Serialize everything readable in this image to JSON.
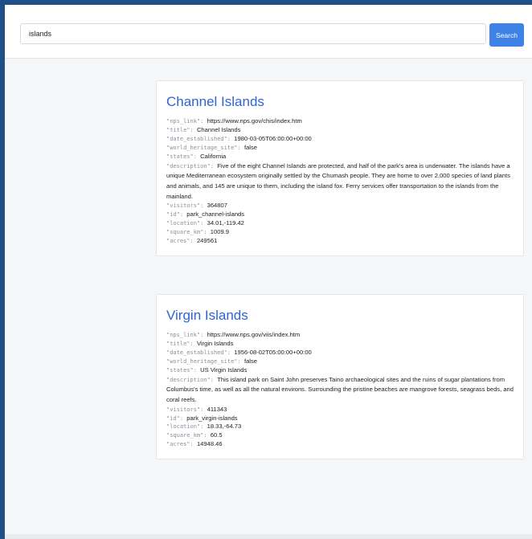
{
  "search": {
    "value": "islands",
    "button_label": "Search"
  },
  "results": [
    {
      "title": "Channel Islands",
      "fields": [
        {
          "key": "\"nps_link\"",
          "value": "https://www.nps.gov/chis/index.htm"
        },
        {
          "key": "\"title\"",
          "value": "Channel Islands"
        },
        {
          "key": "\"date_established\"",
          "value": "1980-03-05T06:00:00+00:00"
        },
        {
          "key": "\"world_heritage_site\"",
          "value": "false"
        },
        {
          "key": "\"states\"",
          "value": "California"
        },
        {
          "key": "\"description\"",
          "value": "Five of the eight Channel Islands are protected, and half of the park's area is underwater. The islands have a unique Mediterranean ecosystem originally settled by the Chumash people. They are home to over 2,000 species of land plants and animals, and 145 are unique to them, including the island fox. Ferry services offer transportation to the islands from the mainland."
        },
        {
          "key": "\"visitors\"",
          "value": "364807"
        },
        {
          "key": "\"id\"",
          "value": "park_channel-islands"
        },
        {
          "key": "\"location\"",
          "value": "34.01,-119.42"
        },
        {
          "key": "\"square_km\"",
          "value": "1009.9"
        },
        {
          "key": "\"acres\"",
          "value": "249561"
        }
      ]
    },
    {
      "title": "Virgin Islands",
      "fields": [
        {
          "key": "\"nps_link\"",
          "value": "https://www.nps.gov/viis/index.htm"
        },
        {
          "key": "\"title\"",
          "value": "Virgin Islands"
        },
        {
          "key": "\"date_established\"",
          "value": "1956-08-02T05:00:00+00:00"
        },
        {
          "key": "\"world_heritage_site\"",
          "value": "false"
        },
        {
          "key": "\"states\"",
          "value": "US Virgin Islands"
        },
        {
          "key": "\"description\"",
          "value": "This island park on Saint John preserves Taino archaeological sites and the ruins of sugar plantations from Columbus's time, as well as all the natural environs. Surrounding the pristine beaches are mangrove forests, seagrass beds, and coral reefs."
        },
        {
          "key": "\"visitors\"",
          "value": "411343"
        },
        {
          "key": "\"id\"",
          "value": "park_virgin-islands"
        },
        {
          "key": "\"location\"",
          "value": "18.33,-64.73"
        },
        {
          "key": "\"square_km\"",
          "value": "60.5"
        },
        {
          "key": "\"acres\"",
          "value": "14948.46"
        }
      ]
    }
  ]
}
